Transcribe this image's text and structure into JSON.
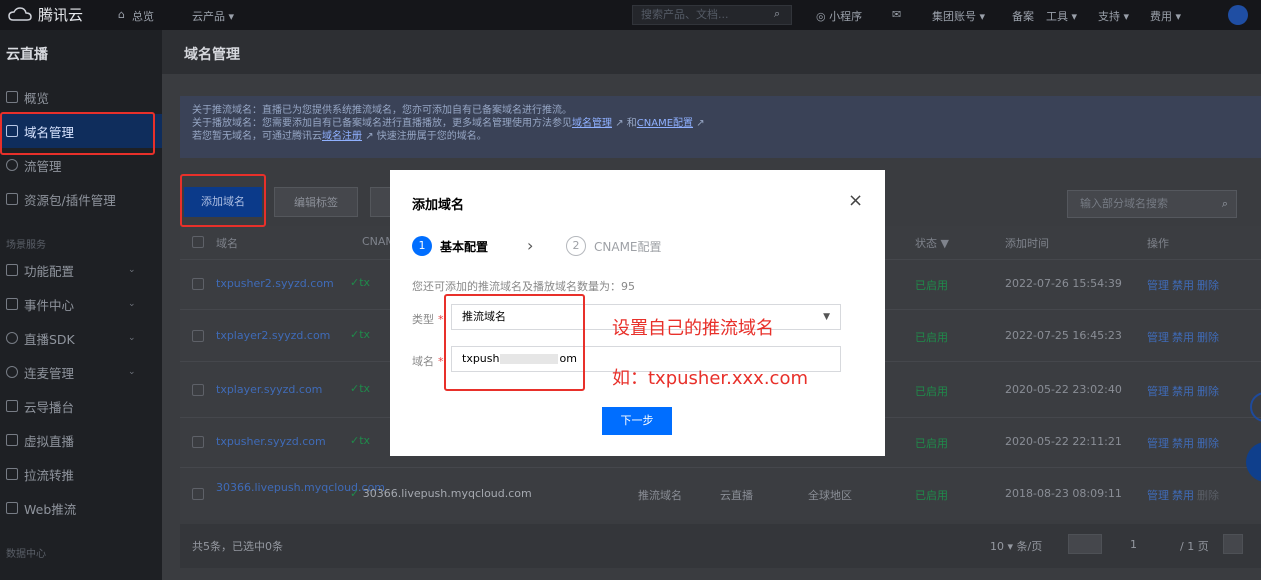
{
  "topbar": {
    "brand": "腾讯云",
    "overview": "总览",
    "products": "云产品",
    "search_placeholder": "搜索产品、文档...",
    "mini_program": "小程序",
    "account": "集团账号",
    "filing": "备案",
    "tools": "工具",
    "support": "支持",
    "billing": "费用"
  },
  "sidebar": {
    "title": "云直播",
    "items": [
      {
        "label": "概览"
      },
      {
        "label": "域名管理"
      },
      {
        "label": "流管理"
      },
      {
        "label": "资源包/插件管理"
      }
    ],
    "section_label": "场景服务",
    "scene_items": [
      {
        "label": "功能配置"
      },
      {
        "label": "事件中心"
      },
      {
        "label": "直播SDK"
      },
      {
        "label": "连麦管理"
      },
      {
        "label": "云导播台"
      },
      {
        "label": "虚拟直播"
      },
      {
        "label": "拉流转推"
      },
      {
        "label": "Web推流"
      }
    ],
    "data_section": "数据中心"
  },
  "page": {
    "title": "域名管理",
    "notice": {
      "line1": "关于推流域名：直播已为您提供系统推流域名，您亦可添加自有已备案域名进行推流。",
      "line2_prefix": "关于播放域名：您需要添加自有已备案域名进行直播播放，更多域名管理使用方法参见",
      "line2_link1": "域名管理",
      "line2_mid": "和",
      "line2_link2": "CNAME配置",
      "line3_prefix": "若您暂无域名，可通过腾讯云",
      "line3_link": "域名注册",
      "line3_suffix": "快速注册属于您的域名。"
    },
    "add_domain_btn": "添加域名",
    "edit_tag_btn": "编辑标签",
    "search_placeholder": "输入部分域名搜索"
  },
  "table": {
    "headers": {
      "domain": "域名",
      "cname": "CNAME",
      "status": "状态",
      "time": "添加时间",
      "ops": "操作"
    },
    "rows": [
      {
        "domain": "txpusher2.syyzd.com",
        "cname": "tx",
        "type": "",
        "scene": "",
        "region": "",
        "status": "已启用",
        "time": "2022-07-26 15:54:39",
        "op1": "管理",
        "op2": "禁用",
        "op3": "删除"
      },
      {
        "domain": "txplayer2.syyzd.com",
        "cname": "tx",
        "type": "",
        "scene": "",
        "region": "",
        "status": "已启用",
        "time": "2022-07-25 16:45:23",
        "op1": "管理",
        "op2": "禁用",
        "op3": "删除"
      },
      {
        "domain": "txplayer.syyzd.com",
        "cname": "tx",
        "type": "",
        "scene": "",
        "region": "",
        "status": "已启用",
        "time": "2020-05-22 23:02:40",
        "op1": "管理",
        "op2": "禁用",
        "op3": "删除"
      },
      {
        "domain": "txpusher.syyzd.com",
        "cname": "tx",
        "type": "",
        "scene": "",
        "region": "",
        "status": "已启用",
        "time": "2020-05-22 22:11:21",
        "op1": "管理",
        "op2": "禁用",
        "op3": "删除"
      },
      {
        "domain": "30366.livepush.myqcloud.com",
        "cname": "30366.livepush.myqcloud.com",
        "type": "推流域名",
        "scene": "云直播",
        "region": "全球地区",
        "status": "已启用",
        "time": "2018-08-23 08:09:11",
        "op1": "管理",
        "op2": "禁用",
        "op3": "删除"
      }
    ],
    "footer_count": "共5条，已选中0条",
    "page_size": "10",
    "page_size_unit": "条/页",
    "page_current": "1",
    "page_total": "/ 1 页"
  },
  "modal": {
    "title": "添加域名",
    "step1_num": "1",
    "step1_label": "基本配置",
    "step2_num": "2",
    "step2_label": "CNAME配置",
    "hint": "您还可添加的推流域名及播放域名数量为：95",
    "type_label": "类型",
    "type_value": "推流域名",
    "domain_label": "域名",
    "domain_value_prefix": "txpush",
    "domain_value_suffix": "om",
    "next_btn": "下一步"
  },
  "annotations": {
    "set_domain": "设置自己的推流域名",
    "example": "如：txpusher.xxx.com",
    "color": "#e8302a"
  },
  "colors": {
    "primary": "#006eff",
    "sidebar_active": "#0f2d5c"
  }
}
